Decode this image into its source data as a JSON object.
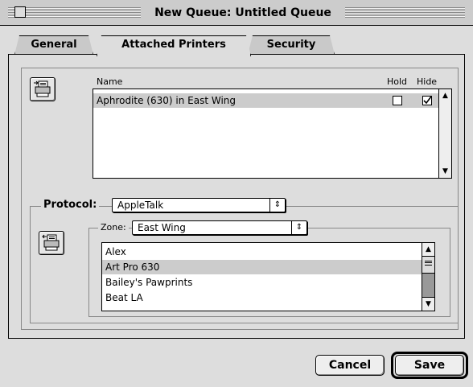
{
  "window": {
    "title": "New Queue: Untitled Queue"
  },
  "tabs": [
    {
      "label": "General",
      "active": false
    },
    {
      "label": "Attached Printers",
      "active": true
    },
    {
      "label": "Security",
      "active": false
    }
  ],
  "attached": {
    "columns": {
      "name": "Name",
      "hold": "Hold",
      "hide": "Hide"
    },
    "rows": [
      {
        "name": "Aphrodite (630) in East Wing",
        "hold": false,
        "hide": true,
        "selected": true
      }
    ]
  },
  "protocol": {
    "label": "Protocol:",
    "value": "AppleTalk",
    "zone_label": "Zone:",
    "zone_value": "East Wing",
    "printers": [
      {
        "name": "Alex",
        "selected": false
      },
      {
        "name": "Art Pro 630",
        "selected": true
      },
      {
        "name": "Bailey's Pawprints",
        "selected": false
      },
      {
        "name": "Beat LA",
        "selected": false
      }
    ]
  },
  "buttons": {
    "cancel": "Cancel",
    "save": "Save"
  },
  "icons": {
    "remove_printer": "printer-remove-icon",
    "add_printer": "printer-add-icon"
  }
}
